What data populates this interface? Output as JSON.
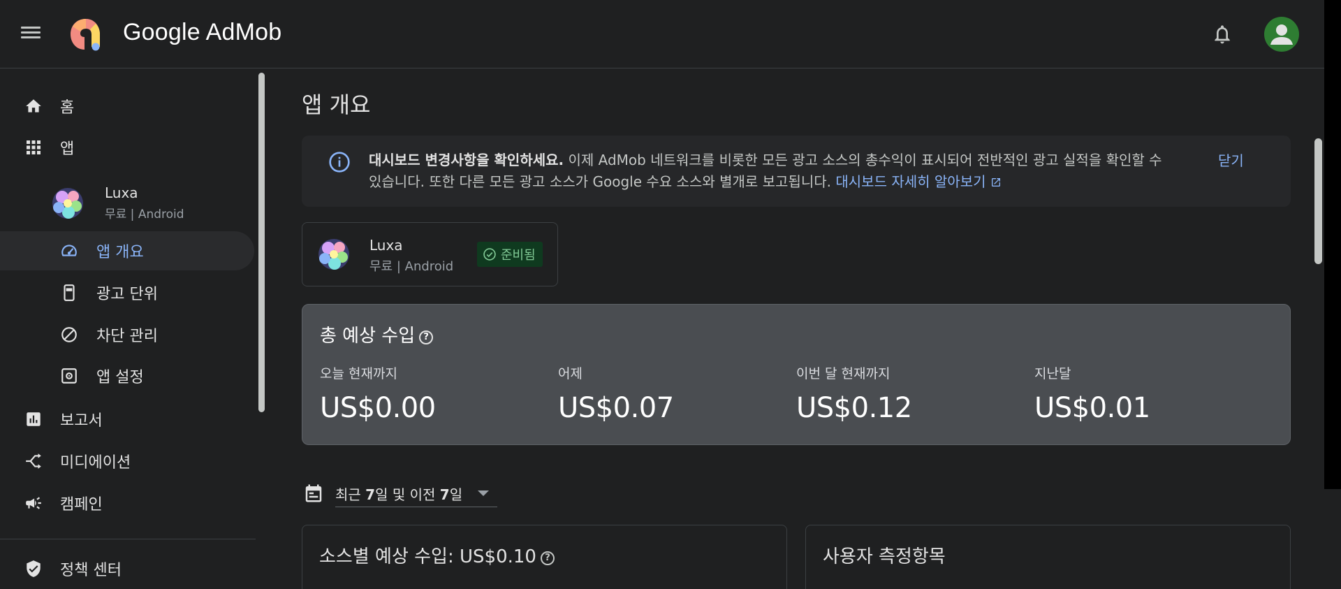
{
  "header": {
    "brand": "Google AdMob",
    "menu_icon": "menu-icon",
    "bell_icon": "bell-icon",
    "avatar_icon": "avatar-icon"
  },
  "sidebar": {
    "home": "홈",
    "apps": "앱",
    "app": {
      "name": "Luxa",
      "meta": "무료 | Android"
    },
    "app_overview": "앱 개요",
    "ad_units": "광고 단위",
    "blocking": "차단 관리",
    "app_settings": "앱 설정",
    "reports": "보고서",
    "mediation": "미디에이션",
    "campaigns": "캠페인",
    "policy_center": "정책 센터"
  },
  "main": {
    "title": "앱 개요",
    "banner": {
      "bold": "대시보드 변경사항을 확인하세요.",
      "text": " 이제 AdMob 네트워크를 비롯한 모든 광고 소스의 총수익이 표시되어 전반적인 광고 실적을 확인할 수 있습니다. 또한 다른 모든 광고 소스가 Google 수요 소스와 별개로 보고됩니다. ",
      "link": "대시보드 자세히 알아보기",
      "close": "닫기"
    },
    "app_card": {
      "name": "Luxa",
      "meta": "무료 | Android",
      "status": "준비됨"
    },
    "earnings": {
      "title": "총 예상 수입",
      "metrics": [
        {
          "label": "오늘 현재까지",
          "value": "US$0.00"
        },
        {
          "label": "어제",
          "value": "US$0.07"
        },
        {
          "label": "이번 달 현재까지",
          "value": "US$0.12"
        },
        {
          "label": "지난달",
          "value": "US$0.01"
        }
      ]
    },
    "date_range": {
      "prefix": "최근 ",
      "n1": "7",
      "mid": "일 및 이전 ",
      "n2": "7",
      "suffix": "일"
    },
    "panels": {
      "by_source": "소스별 예상 수입: US$0.10",
      "user_metrics": "사용자 측정항목"
    }
  },
  "colors": {
    "accent": "#8ab4f8",
    "background": "#1f2021",
    "success": "#81c995"
  }
}
